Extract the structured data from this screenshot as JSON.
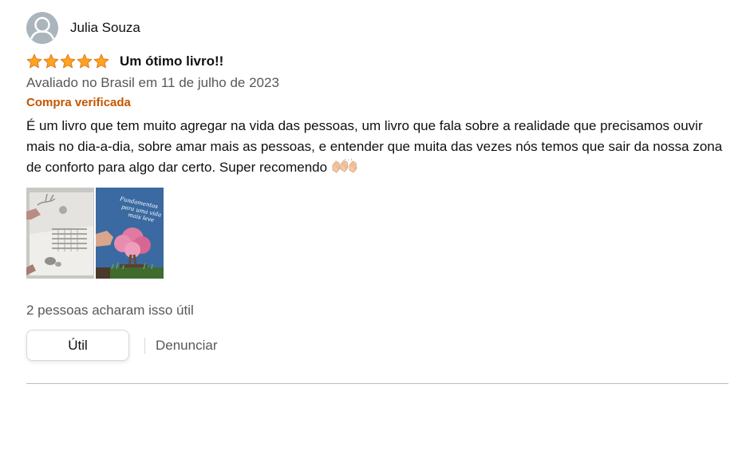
{
  "review": {
    "profile_name": "Julia Souza",
    "rating": 5,
    "max_rating": 5,
    "star_color": "#ffa41c",
    "title": "Um ótimo livro!!",
    "date": "Avaliado no Brasil em 11 de julho de 2023",
    "verified_label": "Compra verificada",
    "verified_color": "#c45500",
    "body": "É um livro que tem muito agregar na vida das pessoas, um livro que fala sobre a realidade que precisamos ouvir mais no dia-a-dia, sobre amar mais as pessoas, e entender que muita das vezes nós temos que sair da nossa zona de conforto para algo dar certo. Super recomendo",
    "body_emoji": "clapping-hands-icon",
    "images": [
      {
        "icon": "open-book-photo"
      },
      {
        "icon": "book-cover-photo",
        "cover_text": "Fundamentos para uma vida mais leve"
      }
    ],
    "helpful_text": "2 pessoas acharam isso útil",
    "helpful_button_label": "Útil",
    "report_label": "Denunciar"
  }
}
